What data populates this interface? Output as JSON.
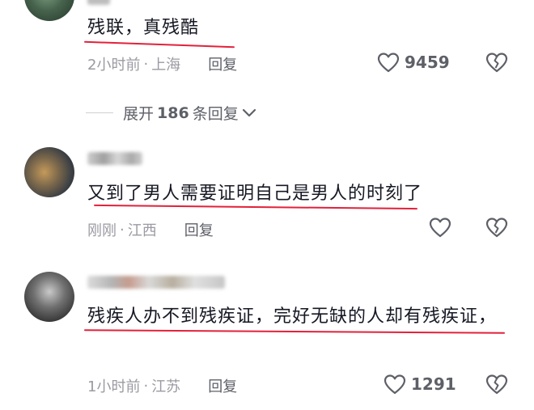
{
  "comments": [
    {
      "text": "残联，真残酷",
      "time": "2小时前",
      "location": "上海",
      "reply_label": "回复",
      "likes": "9459"
    },
    {
      "text": "又到了男人需要证明自己是男人的时刻了",
      "time": "刚刚",
      "location": "江西",
      "reply_label": "回复",
      "likes": ""
    },
    {
      "text": "残疾人办不到残疾证，完好无缺的人却有残疾证，",
      "time": "1小时前",
      "location": "江苏",
      "reply_label": "回复",
      "likes": "1291"
    }
  ],
  "expand_replies": {
    "prefix": "展开",
    "count": "186",
    "suffix": "条回复"
  },
  "meta_separator": "·",
  "colors": {
    "underline": "#e3213a",
    "meta_text": "#9a9aa2",
    "icon": "#5e6068"
  }
}
